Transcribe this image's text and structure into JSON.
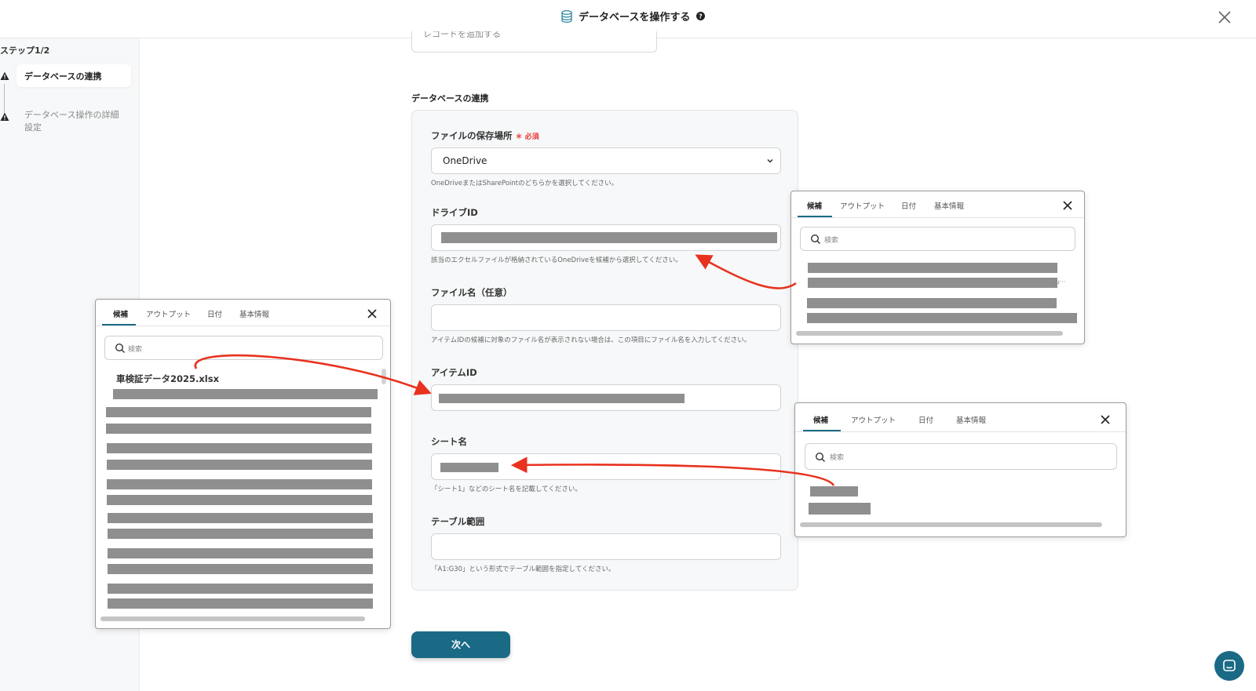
{
  "header": {
    "title": "データベースを操作する",
    "help_icon": "help-circle-icon",
    "db_icon": "database-icon",
    "close_icon": "close-icon"
  },
  "sidebar": {
    "step_label": "ステップ1/2",
    "steps": [
      {
        "label": "データベースの連携",
        "status_icon": "warning-icon",
        "active": true
      },
      {
        "label": "データベース操作の詳細設定",
        "status_icon": "warning-icon",
        "active": false
      }
    ]
  },
  "main": {
    "top_select_value": "レコードを追加する",
    "section_title": "データベースの連携",
    "fields": {
      "storage": {
        "label": "ファイルの保存場所",
        "required": "必須",
        "value": "OneDrive",
        "hint": "OneDriveまたはSharePointのどちらかを選択してください。"
      },
      "drive_id": {
        "label": "ドライブID",
        "hint": "該当のエクセルファイルが格納されているOneDriveを候補から選択してください。"
      },
      "file_name": {
        "label": "ファイル名（任意）",
        "hint": "アイテムIDの候補に対象のファイル名が表示されない場合は、この項目にファイル名を入力してください。"
      },
      "item_id": {
        "label": "アイテムID"
      },
      "sheet_name": {
        "label": "シート名",
        "hint": "「シート1」などのシート名を記載してください。"
      },
      "table_range": {
        "label": "テーブル範囲",
        "hint": "「A1:G30」という形式でテーブル範囲を指定してください。"
      }
    },
    "next_button": "次へ"
  },
  "popups": {
    "tabs": [
      "候補",
      "アウトプット",
      "日付",
      "基本情報"
    ],
    "search_placeholder": "検索",
    "left_file_item": "車検証データ2025.xlsx",
    "right_top_truncated": "/u···"
  },
  "colors": {
    "accent": "#1a6a86",
    "required": "#e53935",
    "arrow": "#e8321e",
    "redaction": "#8f8f8f"
  }
}
